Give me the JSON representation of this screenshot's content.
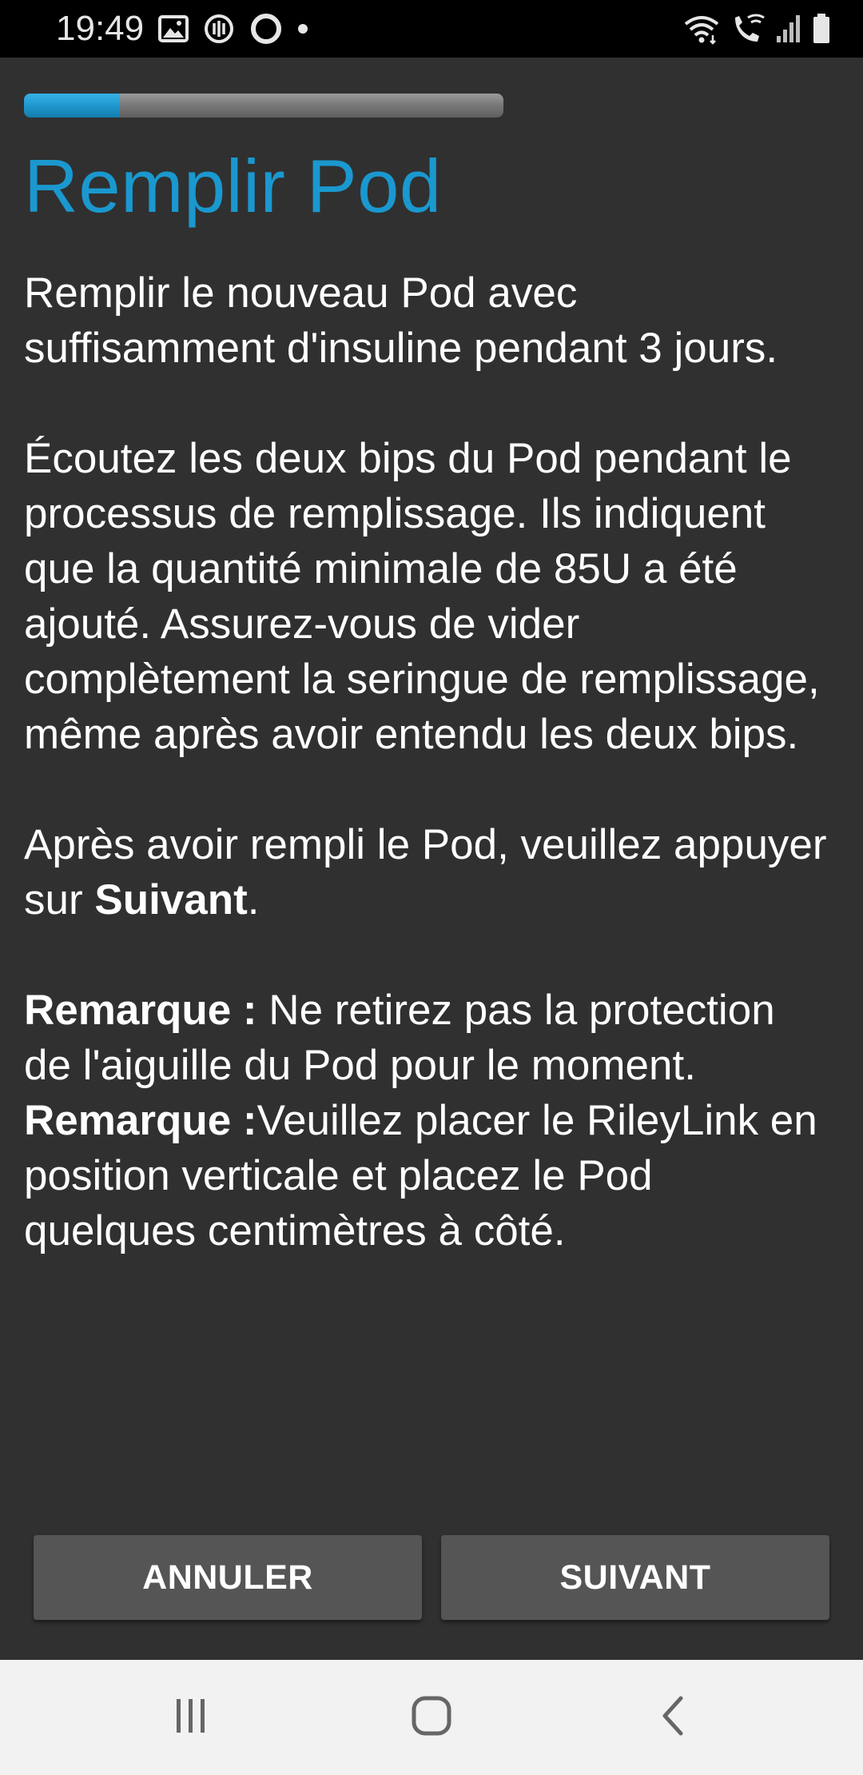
{
  "status_bar": {
    "time": "19:49",
    "left_icons": [
      "image-icon",
      "data-saver-icon",
      "circle-icon",
      "dot-icon"
    ],
    "right_icons": [
      "wifi-icon",
      "wifi-calling-icon",
      "signal-icon",
      "battery-icon"
    ]
  },
  "progress": {
    "value_percent": 20,
    "fill_color": "#1f98cf",
    "track_color": "#7a7a7a"
  },
  "title": {
    "text": "Remplir Pod",
    "color": "#1a98cf"
  },
  "content": {
    "p1": "Remplir le nouveau Pod avec suffisamment d'insuline pendant 3 jours.",
    "p2": "Écoutez les deux bips du Pod pendant le processus de remplissage. Ils indiquent que la quantité minimale de 85U a été ajouté. Assurez-vous de vider complètement la seringue de remplissage, même après avoir entendu les deux bips.",
    "p3_prefix": "Après avoir rempli le Pod, veuillez appuyer sur ",
    "p3_bold": "Suivant",
    "p3_suffix": ".",
    "note1_label": "Remarque :",
    "note1_text": " Ne retirez pas la protection de l'aiguille du Pod pour le moment.",
    "note2_label": "Remarque :",
    "note2_text": "Veuillez placer le RileyLink en position verticale et placez le Pod quelques centimètres à côté."
  },
  "buttons": {
    "cancel_label": "ANNULER",
    "next_label": "SUIVANT"
  },
  "nav_bar": {
    "icons": [
      "recent-apps-icon",
      "home-icon",
      "back-icon"
    ]
  }
}
